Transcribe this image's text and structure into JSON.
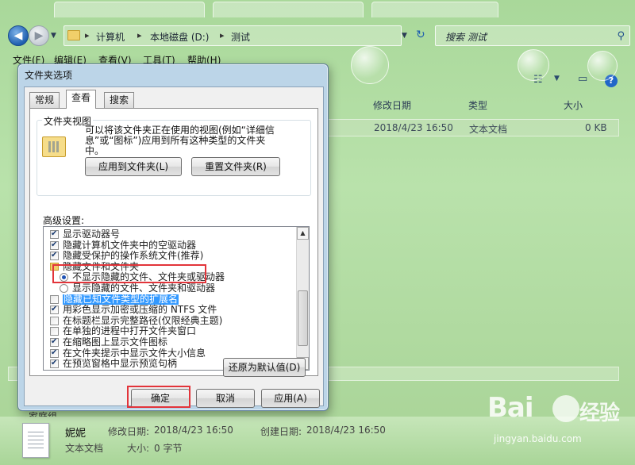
{
  "address_bar": {
    "crumbs": [
      "计算机",
      "本地磁盘 (D:)",
      "测试"
    ],
    "search_placeholder": "搜索 测试"
  },
  "menu": [
    "文件(F)",
    "编辑(E)",
    "查看(V)",
    "工具(T)",
    "帮助(H)"
  ],
  "file_list": {
    "columns": [
      "修改日期",
      "类型",
      "大小"
    ],
    "rows": [
      {
        "modified": "2018/4/23 16:50",
        "type": "文本文档",
        "size": "0 KB"
      }
    ]
  },
  "nav_pane_partial": "家庭组",
  "details_pane": {
    "name": "妮妮",
    "type": "文本文档",
    "modified_label": "修改日期:",
    "modified": "2018/4/23 16:50",
    "created_label": "创建日期:",
    "created": "2018/4/23 16:50",
    "size_label": "大小:",
    "size": "0 字节"
  },
  "dialog": {
    "title": "文件夹选项",
    "tabs": [
      "常规",
      "查看",
      "搜索"
    ],
    "active_tab": "查看",
    "folder_view": {
      "label": "文件夹视图",
      "desc_lines": [
        "可以将该文件夹正在使用的视图(例如“详细信",
        "息”或“图标”)应用到所有这种类型的文件夹",
        "中。"
      ],
      "apply_button": "应用到文件夹(L)",
      "reset_button": "重置文件夹(R)"
    },
    "advanced_label": "高级设置:",
    "tree": [
      {
        "kind": "checkbox",
        "checked": true,
        "indent": 0,
        "text": "显示驱动器号"
      },
      {
        "kind": "checkbox",
        "checked": true,
        "indent": 0,
        "text": "隐藏计算机文件夹中的空驱动器"
      },
      {
        "kind": "checkbox",
        "checked": true,
        "indent": 0,
        "text": "隐藏受保护的操作系统文件(推荐)"
      },
      {
        "kind": "folder",
        "checked": false,
        "indent": 0,
        "text": "隐藏文件和文件夹"
      },
      {
        "kind": "radio",
        "checked": true,
        "indent": 1,
        "text": "不显示隐藏的文件、文件夹或驱动器"
      },
      {
        "kind": "radio",
        "checked": false,
        "indent": 1,
        "text": "显示隐藏的文件、文件夹和驱动器"
      },
      {
        "kind": "checkbox",
        "checked": false,
        "indent": 0,
        "text": "隐藏已知文件类型的扩展名",
        "selected": true
      },
      {
        "kind": "checkbox",
        "checked": true,
        "indent": 0,
        "text": "用彩色显示加密或压缩的 NTFS 文件"
      },
      {
        "kind": "checkbox",
        "checked": false,
        "indent": 0,
        "text": "在标题栏显示完整路径(仅限经典主题)"
      },
      {
        "kind": "checkbox",
        "checked": false,
        "indent": 0,
        "text": "在单独的进程中打开文件夹窗口"
      },
      {
        "kind": "checkbox",
        "checked": true,
        "indent": 0,
        "text": "在缩略图上显示文件图标"
      },
      {
        "kind": "checkbox",
        "checked": true,
        "indent": 0,
        "text": "在文件夹提示中显示文件大小信息"
      },
      {
        "kind": "checkbox",
        "checked": true,
        "indent": 0,
        "text": "在预览窗格中显示预览句柄"
      }
    ],
    "restore_button": "还原为默认值(D)",
    "ok_button": "确定",
    "cancel_button": "取消",
    "apply_button": "应用(A)"
  },
  "watermark": {
    "brand": "Bai",
    "brand2": "经验",
    "site": "jingyan.baidu.com"
  }
}
